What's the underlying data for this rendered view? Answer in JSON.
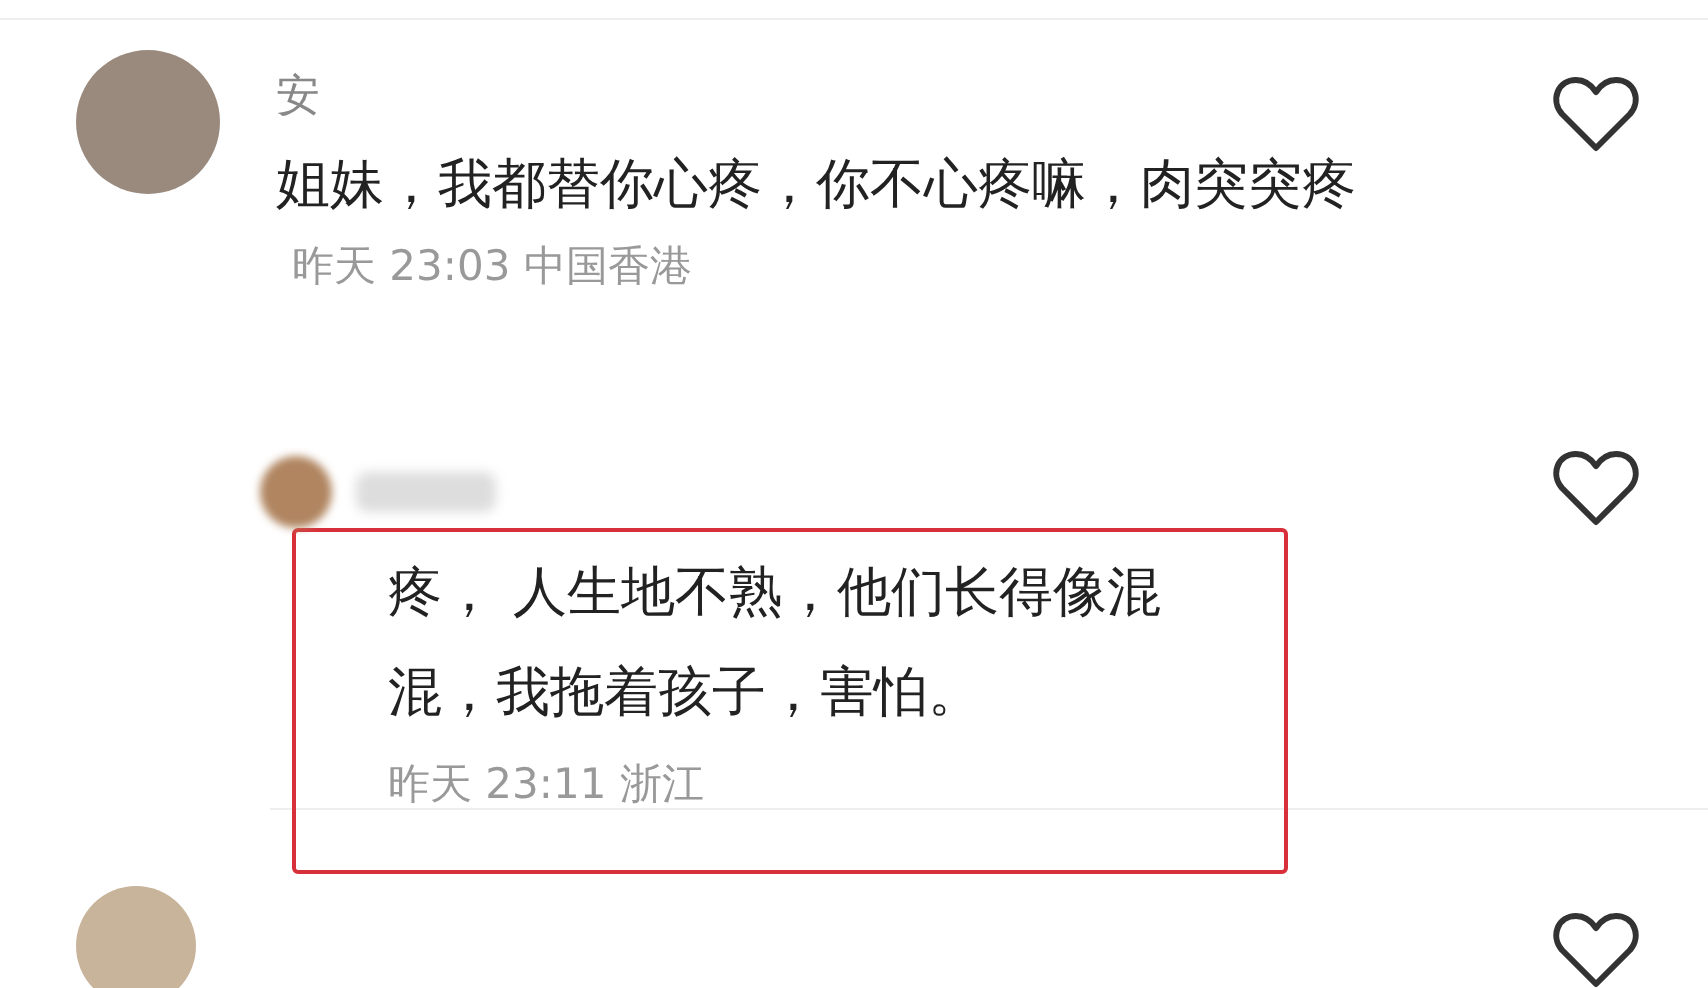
{
  "comments": [
    {
      "kind": "comment",
      "name": "安",
      "text": "姐妹，我都替你心疼，你不心疼嘛，肉突突疼",
      "meta": "昨天 23:03 中国香港",
      "highlighted": false,
      "name_blurred": false
    },
    {
      "kind": "reply",
      "text": "疼， 人生地不熟，他们长得像混混，我拖着孩子，害怕。",
      "meta": "昨天 23:11 浙江",
      "highlighted": true,
      "name_blurred": true
    }
  ]
}
